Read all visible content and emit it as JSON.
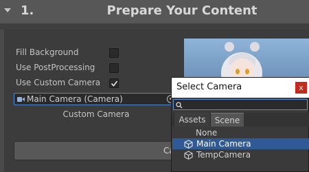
{
  "header": {
    "step": "1.",
    "title": "Prepare Your Content"
  },
  "settings": {
    "fill_background": "Fill Background",
    "use_postprocessing": "Use PostProcessing",
    "use_custom_camera": "Use Custom Camera",
    "camera_field_value": "Main Camera (Camera)",
    "custom_camera_label": "Custom Camera",
    "capture_button": "Captu"
  },
  "dialog": {
    "title": "Select Camera",
    "close": "x",
    "tabs": [
      "Assets",
      "Scene"
    ],
    "items": [
      "None",
      "Main Camera",
      "TempCamera"
    ]
  },
  "colors": {
    "selection": "#2f5a96",
    "focus_border": "#4d8ad8",
    "close_button": "#c42b1c"
  }
}
